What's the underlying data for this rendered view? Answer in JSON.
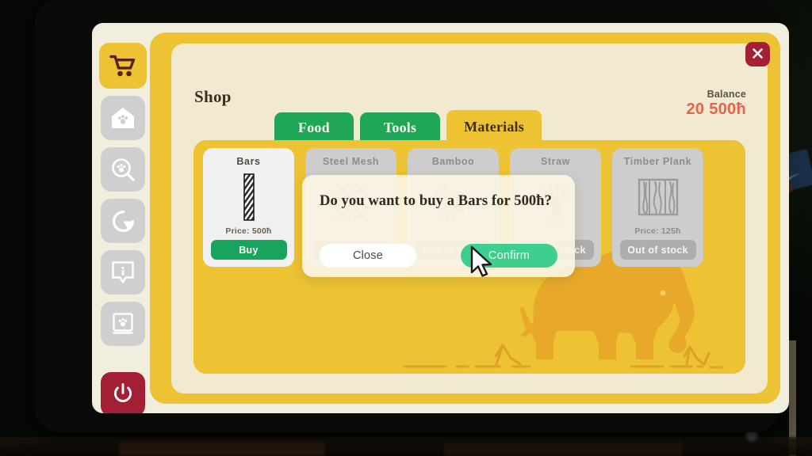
{
  "window": {
    "app_title": "Shop",
    "close_icon": "close-x-icon"
  },
  "sidebar": {
    "items": [
      {
        "id": "shop",
        "icon": "shopping-cart-icon",
        "active": true
      },
      {
        "id": "home",
        "icon": "pet-house-icon",
        "active": false
      },
      {
        "id": "search",
        "icon": "paw-search-icon",
        "active": false
      },
      {
        "id": "progress",
        "icon": "refresh-circle-icon",
        "active": false
      },
      {
        "id": "info",
        "icon": "info-bubble-icon",
        "active": false
      },
      {
        "id": "journal",
        "icon": "paw-book-icon",
        "active": false
      }
    ],
    "power": {
      "icon": "power-icon"
    }
  },
  "header": {
    "title": "Shop",
    "balance_label": "Balance",
    "balance_value": "20 500ħ"
  },
  "tabs": [
    {
      "label": "Food",
      "active": false
    },
    {
      "label": "Tools",
      "active": false
    },
    {
      "label": "Materials",
      "active": true
    }
  ],
  "products": [
    {
      "name": "Bars",
      "icon": "metal-bar-icon",
      "price_label": "Price: 500ħ",
      "button_label": "Buy",
      "available": true
    },
    {
      "name": "Steel Mesh",
      "icon": "steel-mesh-icon",
      "price_label": "",
      "button_label": "Out of stock",
      "available": false
    },
    {
      "name": "Bamboo",
      "icon": "bamboo-icon",
      "price_label": "",
      "button_label": "Out of stock",
      "available": false
    },
    {
      "name": "Straw",
      "icon": "straw-icon",
      "price_label": "",
      "button_label": "Out of stock",
      "available": false
    },
    {
      "name": "Timber Plank",
      "icon": "timber-plank-icon",
      "price_label": "Price: 125ħ",
      "button_label": "Out of stock",
      "available": false
    }
  ],
  "modal": {
    "message": "Do you want to buy a Bars for 500ħ?",
    "close_label": "Close",
    "confirm_label": "Confirm"
  },
  "decoration": {
    "elephant": "elephant-silhouette"
  },
  "colors": {
    "panel_yellow": "#edc233",
    "cream": "#f2ead0",
    "tab_green": "#1fa657",
    "buy_green": "#18a45c",
    "confirm_green": "#3ecf8e",
    "balance_red": "#e2644c",
    "power_red": "#a31f35",
    "card_gray": "#cdcdcd",
    "card_white": "#f1f1f1"
  }
}
